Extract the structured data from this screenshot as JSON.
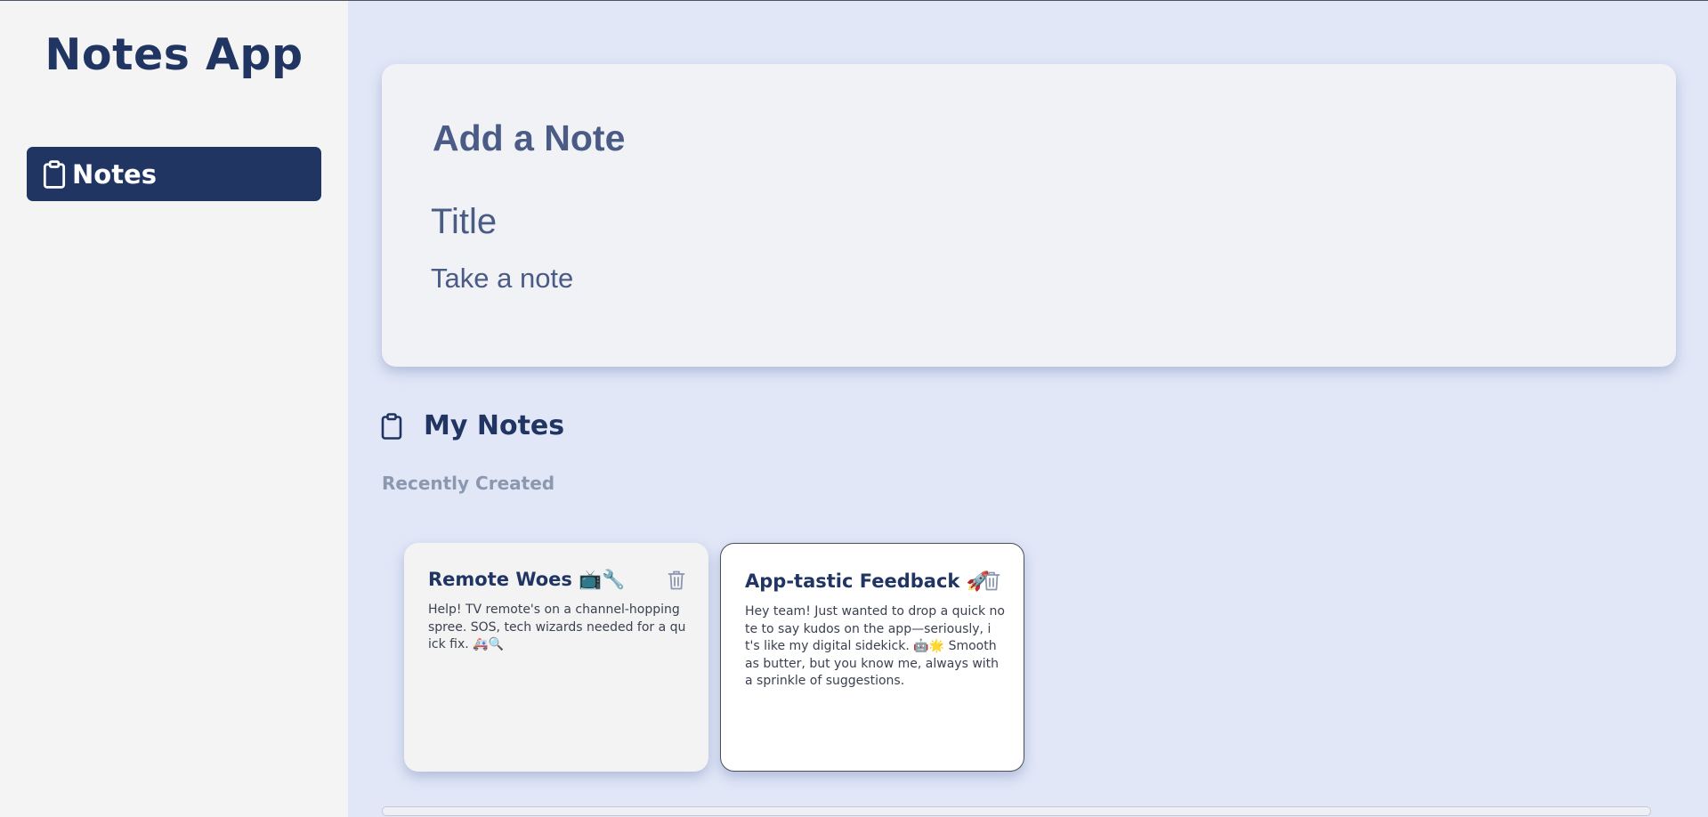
{
  "sidebar": {
    "app_title": "Notes App",
    "items": [
      {
        "label": "Notes",
        "icon": "clipboard-icon",
        "active": true
      }
    ]
  },
  "add_note": {
    "heading": "Add a Note",
    "title_placeholder": "Title",
    "note_placeholder": "Take a note"
  },
  "notes_section": {
    "title": "My Notes",
    "subtitle": "Recently Created",
    "notes": [
      {
        "title": "Remote Woes 📺🔧",
        "body": "Help! TV remote's on a channel-hopping spree. SOS, tech wizards needed for a quick fix. 🚑🔍"
      },
      {
        "title": "App-tastic Feedback 🚀",
        "body": "Hey team! Just wanted to drop a quick note to say kudos on the app—seriously, it's like my digital sidekick. 🤖🌟 Smooth as butter, but you know me, always with a sprinkle of suggestions."
      }
    ]
  },
  "colors": {
    "brand": "#213563",
    "background": "#e1e7f7",
    "sidebar": "#f4f4f4",
    "muted": "#8c97b0"
  }
}
